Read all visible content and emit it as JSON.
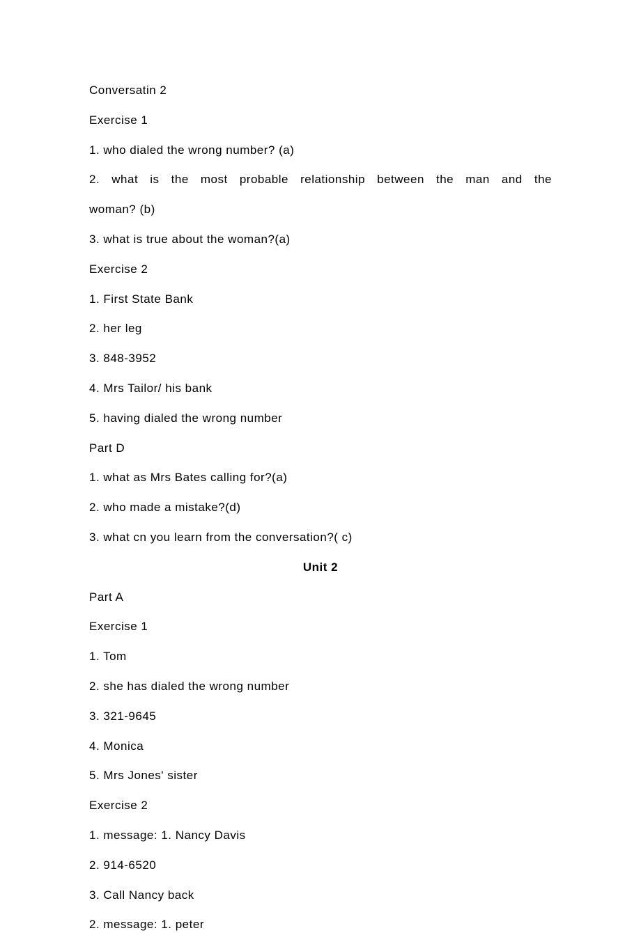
{
  "lines": [
    {
      "text": "Conversatin 2",
      "class": "line"
    },
    {
      "text": "Exercise 1",
      "class": "line"
    },
    {
      "text": "1. who dialed the wrong number? (a)",
      "class": "line"
    },
    {
      "text": "2. what is the most probable relationship between the man and the",
      "class": "line justified"
    },
    {
      "text": "woman? (b)",
      "class": "line"
    },
    {
      "text": "3. what is true about the woman?(a)",
      "class": "line"
    },
    {
      "text": "Exercise 2",
      "class": "line"
    },
    {
      "text": "1. First State Bank",
      "class": "line"
    },
    {
      "text": "2. her leg",
      "class": "line"
    },
    {
      "text": "3. 848-3952",
      "class": "line"
    },
    {
      "text": "4. Mrs Tailor/ his bank",
      "class": "line"
    },
    {
      "text": "5. having dialed the wrong number",
      "class": "line"
    },
    {
      "text": "Part D",
      "class": "line"
    },
    {
      "text": "1. what as Mrs Bates calling for?(a)",
      "class": "line"
    },
    {
      "text": "2. who made a mistake?(d)",
      "class": "line"
    },
    {
      "text": "3. what cn you learn from the conversation?( c)",
      "class": "line"
    },
    {
      "text": "Unit 2",
      "class": "center-heading"
    },
    {
      "text": "Part A",
      "class": "line"
    },
    {
      "text": "Exercise 1",
      "class": "line"
    },
    {
      "text": "1. Tom",
      "class": "line"
    },
    {
      "text": "2. she has dialed the wrong number",
      "class": "line"
    },
    {
      "text": "3. 321-9645",
      "class": "line"
    },
    {
      "text": "4. Monica",
      "class": "line"
    },
    {
      "text": "5. Mrs Jones'  sister",
      "class": "line"
    },
    {
      "text": "Exercise 2",
      "class": "line"
    },
    {
      "text": "1. message: 1. Nancy Davis",
      "class": "line"
    },
    {
      "text": "2. 914-6520",
      "class": "line"
    },
    {
      "text": "3. Call Nancy back",
      "class": "line"
    },
    {
      "text": "2. message: 1. peter",
      "class": "line"
    }
  ]
}
